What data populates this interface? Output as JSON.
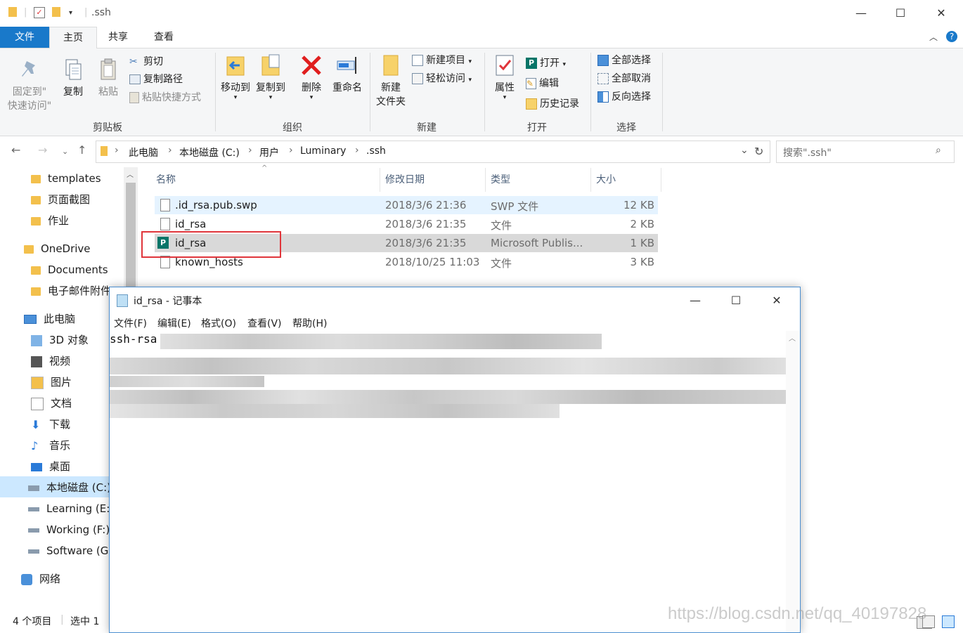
{
  "window": {
    "title": ".ssh",
    "controls": {
      "minimize": "—",
      "maximize": "☐",
      "close": "✕"
    }
  },
  "ribbon_tabs": [
    {
      "label": "文件"
    },
    {
      "label": "主页"
    },
    {
      "label": "共享"
    },
    {
      "label": "查看"
    }
  ],
  "ribbon": {
    "clipboard": {
      "label": "剪贴板",
      "pin_line1": "固定到\"",
      "pin_line2": "快速访问\"",
      "copy": "复制",
      "paste": "粘贴",
      "cut": "剪切",
      "copy_path": "复制路径",
      "paste_shortcut": "粘贴快捷方式"
    },
    "organize": {
      "label": "组织",
      "move_to": "移动到",
      "copy_to": "复制到",
      "delete": "删除",
      "rename": "重命名"
    },
    "new": {
      "label": "新建",
      "new_folder_line1": "新建",
      "new_folder_line2": "文件夹",
      "new_item": "新建项目",
      "easy_access": "轻松访问"
    },
    "open": {
      "label": "打开",
      "properties": "属性",
      "open": "打开",
      "edit": "编辑",
      "history": "历史记录"
    },
    "select": {
      "label": "选择",
      "select_all": "全部选择",
      "select_none": "全部取消",
      "invert": "反向选择"
    }
  },
  "breadcrumb": [
    "此电脑",
    "本地磁盘 (C:)",
    "用户",
    "Luminary",
    ".ssh"
  ],
  "search": {
    "placeholder": "搜索\".ssh\""
  },
  "nav_pane": [
    {
      "label": "templates",
      "icon": "folder-icon"
    },
    {
      "label": "页面截图",
      "icon": "folder-icon"
    },
    {
      "label": "作业",
      "icon": "folder-icon"
    },
    {
      "label": "OneDrive",
      "icon": "folder-icon"
    },
    {
      "label": "Documents",
      "icon": "folder-icon"
    },
    {
      "label": "电子邮件附件",
      "icon": "folder-icon"
    },
    {
      "label": "此电脑",
      "icon": "computer-icon"
    },
    {
      "label": "3D 对象",
      "icon": "3d-objects-icon"
    },
    {
      "label": "视频",
      "icon": "video-icon"
    },
    {
      "label": "图片",
      "icon": "pictures-icon"
    },
    {
      "label": "文档",
      "icon": "documents-icon"
    },
    {
      "label": "下载",
      "icon": "download-icon"
    },
    {
      "label": "音乐",
      "icon": "music-icon"
    },
    {
      "label": "桌面",
      "icon": "desktop-icon"
    },
    {
      "label": "本地磁盘 (C:)",
      "icon": "drive-icon"
    },
    {
      "label": "Learning (E:)",
      "icon": "drive-icon"
    },
    {
      "label": "Working (F:)",
      "icon": "drive-icon"
    },
    {
      "label": "Software (G:",
      "icon": "drive-icon"
    },
    {
      "label": "网络",
      "icon": "network-icon"
    }
  ],
  "columns": {
    "name": "名称",
    "modified": "修改日期",
    "type": "类型",
    "size": "大小"
  },
  "files": [
    {
      "name": ".id_rsa.pub.swp",
      "modified": "2018/3/6 21:36",
      "type": "SWP 文件",
      "size": "12 KB",
      "icon": "file-icon"
    },
    {
      "name": "id_rsa",
      "modified": "2018/3/6 21:35",
      "type": "文件",
      "size": "2 KB",
      "icon": "file-icon"
    },
    {
      "name": "id_rsa",
      "modified": "2018/3/6 21:35",
      "type": "Microsoft Publis...",
      "size": "1 KB",
      "icon": "publisher-icon"
    },
    {
      "name": "known_hosts",
      "modified": "2018/10/25 11:03",
      "type": "文件",
      "size": "3 KB",
      "icon": "file-icon"
    }
  ],
  "status": {
    "count": "4 个项目",
    "selected": "选中 1"
  },
  "notepad": {
    "title": "id_rsa - 记事本",
    "menu": [
      "文件(F)",
      "编辑(E)",
      "格式(O)",
      "查看(V)",
      "帮助(H)"
    ],
    "content_prefix": "ssh-rsa"
  },
  "watermark": "https://blog.csdn.net/qq_40197828",
  "colors": {
    "accent": "#1979ca",
    "highlight_box": "#e0353b",
    "selected_row": "#cce8ff",
    "hover_row": "#d9d9d9"
  }
}
